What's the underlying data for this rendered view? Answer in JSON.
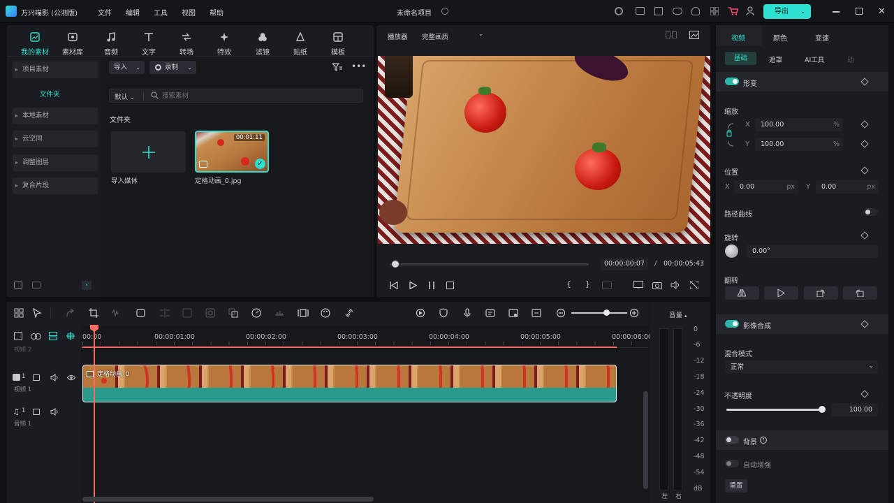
{
  "app": {
    "name": "万兴喵影 (公测版)",
    "menu": [
      "文件",
      "编辑",
      "工具",
      "视图",
      "帮助"
    ],
    "project_title": "未命名项目",
    "export_label": "导出"
  },
  "library": {
    "tabs": [
      "我的素材",
      "素材库",
      "音频",
      "文字",
      "转场",
      "特效",
      "滤镜",
      "贴纸",
      "模板"
    ],
    "active_tab": "我的素材",
    "sidebar": {
      "project_media": "项目素材",
      "folder": "文件夹",
      "items": [
        "本地素材",
        "云空间",
        "调整图层",
        "复合片段"
      ]
    },
    "import_label": "导入",
    "record_label": "录制",
    "sort_label": "默认",
    "search_placeholder": "搜索素材",
    "section_title": "文件夹",
    "import_media_label": "导入媒体",
    "media_item": {
      "name": "定格动画_0.jpg",
      "duration": "00:01:11"
    }
  },
  "player": {
    "label": "播放器",
    "quality": "完整画质",
    "current_time": "00:00:00:07",
    "separator": "/",
    "total_time": "00:00:05:43"
  },
  "inspector": {
    "tabs": [
      "视频",
      "颜色",
      "变速"
    ],
    "subtabs": [
      "基础",
      "遮罩",
      "AI工具",
      "动"
    ],
    "transform": "形变",
    "scale": "缩放",
    "x_label": "X",
    "y_label": "Y",
    "scale_x": "100.00",
    "scale_y": "100.00",
    "percent": "%",
    "position": "位置",
    "pos_x": "0.00",
    "pos_y": "0.00",
    "px": "px",
    "path_curve": "路径曲线",
    "rotation": "旋转",
    "rotation_value": "0.00°",
    "flip": "翻转",
    "compositing": "影像合成",
    "blend_mode_label": "混合模式",
    "blend_mode_value": "正常",
    "opacity_label": "不透明度",
    "opacity_value": "100.00",
    "opacity_fraction": 1.0,
    "background": "背景",
    "auto_enhance": "自动增强",
    "reset": "重置"
  },
  "timeline": {
    "ruler": [
      "00:00",
      "00:00:01:00",
      "00:00:02:00",
      "00:00:03:00",
      "00:00:04:00",
      "00:00:05:00",
      "00:00:06:00"
    ],
    "video2_label": "视频 2",
    "video1_num": "1",
    "video1_label": "视频 1",
    "audio1_num": "1",
    "audio1_label": "音频 1",
    "clip_name": "定格动画_0"
  },
  "meter": {
    "title": "音量",
    "scale": [
      "0",
      "-6",
      "-12",
      "-18",
      "-24",
      "-30",
      "-36",
      "-42",
      "-48",
      "-54",
      "dB"
    ],
    "left": "左",
    "right": "右"
  },
  "colors": {
    "accent": "#2ee0d0",
    "export_bg": "#2ee0d0",
    "playhead": "#ff6b5e",
    "clip": "#2a9a8c"
  }
}
